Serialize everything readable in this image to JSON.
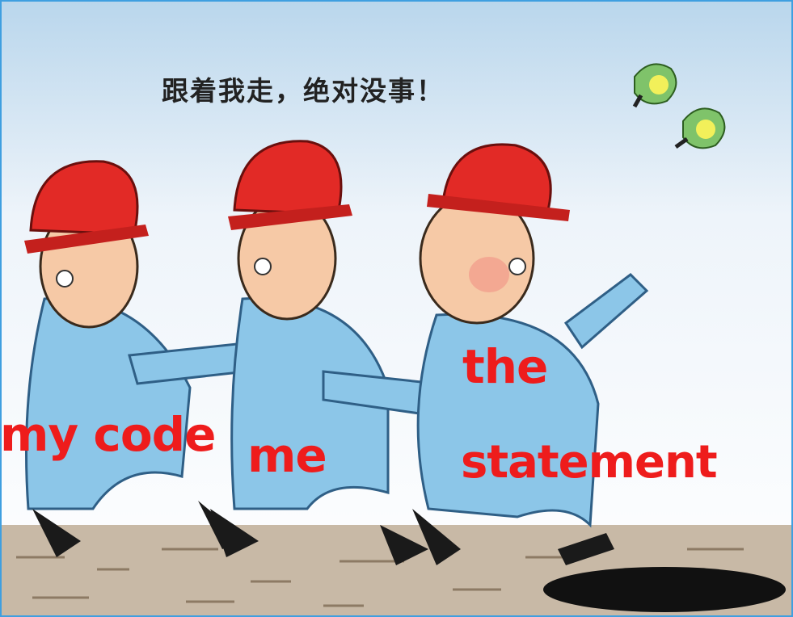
{
  "speech": {
    "text": "跟着我走，绝对没事！"
  },
  "labels": {
    "first_worker": "my code",
    "second_worker": "me",
    "third_worker_line1": "the",
    "third_worker_line2": "statement"
  },
  "colors": {
    "label_red": "#ee1c1c",
    "helmet_red": "#e22a26",
    "uniform_blue": "#8cc6e8",
    "sky_top": "#b9d6ec",
    "ground": "#c8b9a6",
    "manhole": "#111111"
  },
  "icons": [
    "hard-hat-icon",
    "bird-icon",
    "manhole-icon"
  ]
}
